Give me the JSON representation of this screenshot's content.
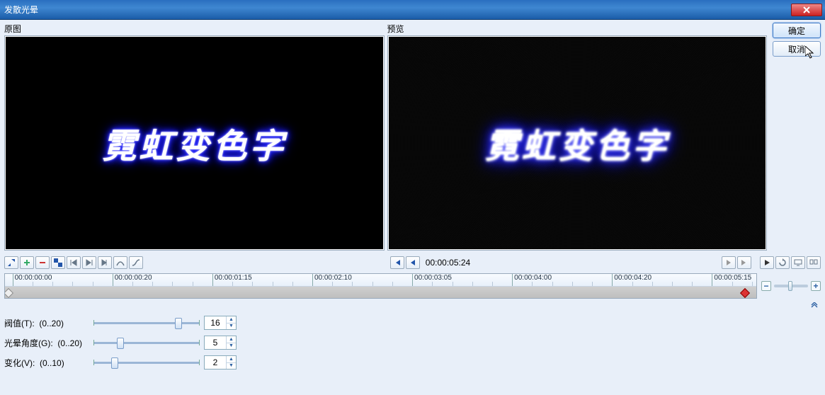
{
  "window": {
    "title": "发散光晕"
  },
  "labels": {
    "original": "原图",
    "preview": "预览"
  },
  "content_text": "霓虹变色字",
  "buttons": {
    "ok": "确定",
    "cancel": "取消"
  },
  "transport": {
    "current_time": "00:00:05:24"
  },
  "timeline": {
    "ticks": [
      "00:00:00:00",
      "00:00:00:20",
      "00:00:01:15",
      "00:00:02:10",
      "00:00:03:05",
      "00:00:04:00",
      "00:00:04:20",
      "00:00:05:15"
    ],
    "last_tick_partial": "00:00:0"
  },
  "zoom": {
    "minus": "−",
    "plus": "+"
  },
  "params": {
    "threshold": {
      "label": "阀值(T):",
      "range": "(0..20)",
      "value": "16",
      "max": 20
    },
    "halo_angle": {
      "label": "光晕角度(G):",
      "range": "(0..20)",
      "value": "5",
      "max": 20
    },
    "variation": {
      "label": "变化(V):",
      "range": "(0..10)",
      "value": "2",
      "max": 10
    }
  },
  "icons": {
    "goto_start": "|◀",
    "step_back": "◀|",
    "step_fwd": "|▶",
    "goto_end": "▶|",
    "play": "▶",
    "loop": "↻"
  }
}
